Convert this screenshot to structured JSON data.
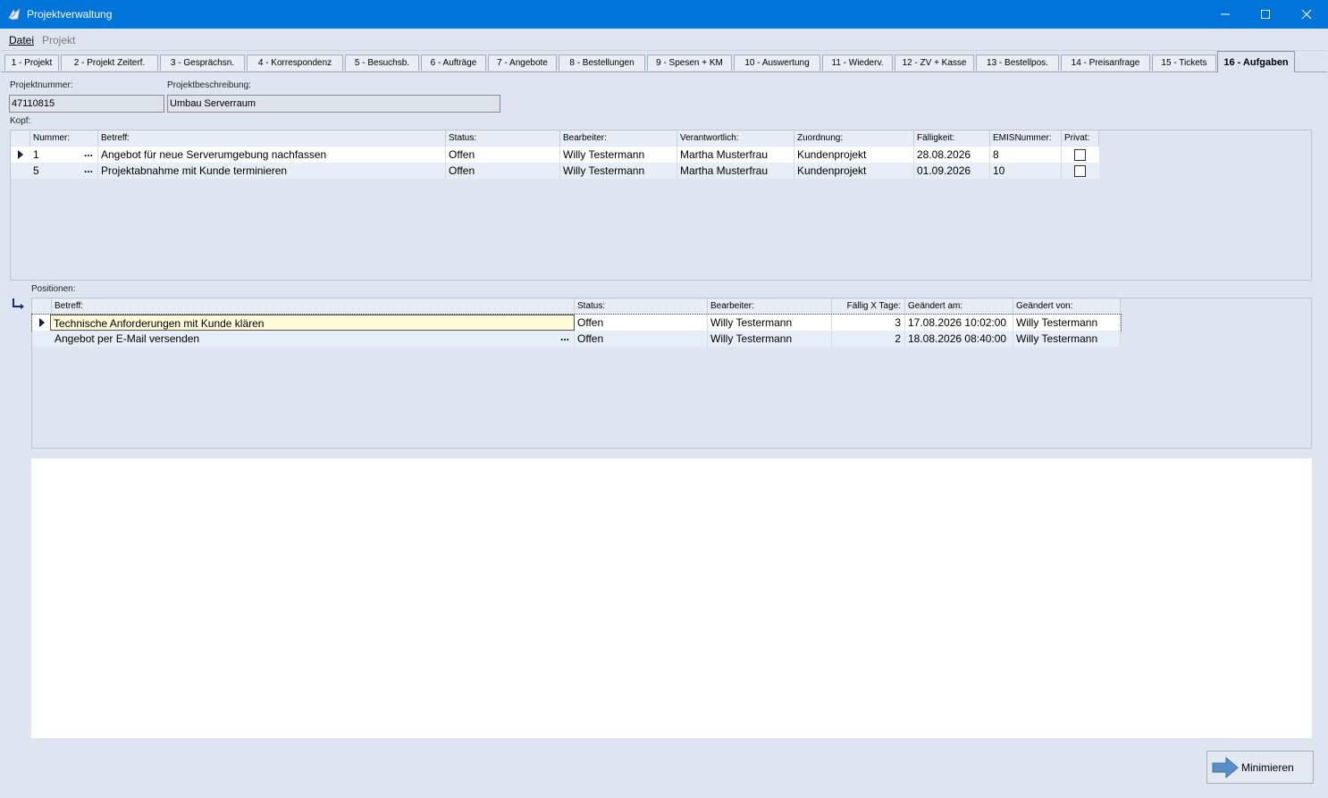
{
  "window": {
    "title": "Projektverwaltung",
    "minimize_icon": "minimize-icon",
    "maximize_icon": "maximize-icon",
    "close_icon": "close-icon"
  },
  "menu": {
    "datei": "Datei",
    "projekt": "Projekt"
  },
  "tabs": [
    "1 - Projekt",
    "2 - Projekt Zeiterf.",
    "3 - Gesprächsn.",
    "4 - Korrespondenz",
    "5 - Besuchsb.",
    "6 - Aufträge",
    "7 - Angebote",
    "8 - Bestellungen",
    "9 - Spesen + KM",
    "10 - Auswertung",
    "11 - Wiederv.",
    "12 - ZV + Kasse",
    "13 - Bestellpos.",
    "14 - Preisanfrage",
    "15 - Tickets",
    "16 - Aufgaben"
  ],
  "header_fields": {
    "projektnummer_label": "Projektnummer:",
    "projektnummer": "47110815",
    "projektbeschreibung_label": "Projektbeschreibung:",
    "projektbeschreibung": "Umbau Serverraum"
  },
  "kopf": {
    "label": "Kopf:",
    "columns": [
      "Nummer:",
      "Betreff:",
      "Status:",
      "Bearbeiter:",
      "Verantwortlich:",
      "Zuordnung:",
      "Fälligkeit:",
      "EMISNummer:",
      "Privat:"
    ],
    "rows": [
      {
        "nummer": "1",
        "betreff": "Angebot für neue Serverumgebung nachfassen",
        "status": "Offen",
        "bearbeiter": "Willy Testermann",
        "verantwortlich": "Martha Musterfrau",
        "zuordnung": "Kundenprojekt",
        "faelligkeit": "28.08.2026",
        "emis": "8",
        "privat": false
      },
      {
        "nummer": "5",
        "betreff": "Projektabnahme mit Kunde terminieren",
        "status": "Offen",
        "bearbeiter": "Willy Testermann",
        "verantwortlich": "Martha Musterfrau",
        "zuordnung": "Kundenprojekt",
        "faelligkeit": "01.09.2026",
        "emis": "10",
        "privat": false
      }
    ]
  },
  "positionen": {
    "label": "Positionen:",
    "columns": [
      "Betreff:",
      "Status:",
      "Bearbeiter:",
      "Fällig X Tage:",
      "Geändert am:",
      "Geändert von:"
    ],
    "rows": [
      {
        "betreff": "Technische Anforderungen mit Kunde klären",
        "status": "Offen",
        "bearbeiter": "Willy Testermann",
        "tage": "3",
        "geaendert_am": "17.08.2026 10:02:00",
        "geaendert_von": "Willy Testermann"
      },
      {
        "betreff": "Angebot per E-Mail versenden",
        "status": "Offen",
        "bearbeiter": "Willy Testermann",
        "tage": "2",
        "geaendert_am": "18.08.2026 08:40:00",
        "geaendert_von": "Willy Testermann"
      }
    ]
  },
  "ellipsis": "...",
  "minimize_button": {
    "label": "Minimieren",
    "icon": "arrow-right-icon"
  },
  "colors": {
    "titlebar": "#0074d9",
    "background": "#dde6f0",
    "selected_cell": "#fdfbd9"
  }
}
